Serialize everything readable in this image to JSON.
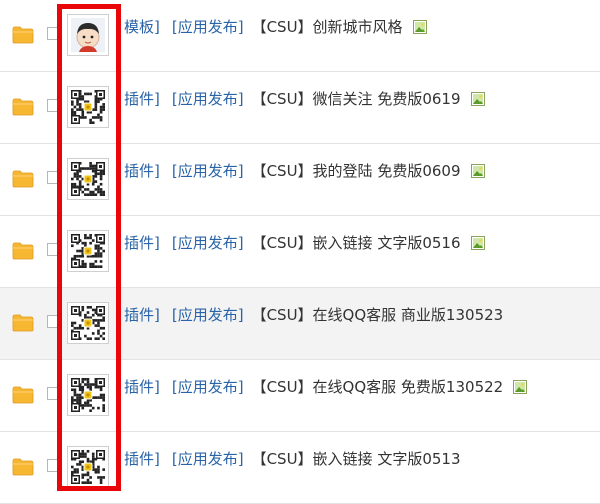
{
  "rows": [
    {
      "category": "模板]",
      "app": "[应用发布]",
      "name": "【CSU】创新城市风格",
      "thumb": "avatar",
      "image_icon": true
    },
    {
      "category": "插件]",
      "app": "[应用发布]",
      "name": "【CSU】微信关注 免费版0619",
      "thumb": "qr",
      "image_icon": true
    },
    {
      "category": "插件]",
      "app": "[应用发布]",
      "name": "【CSU】我的登陆 免费版0609",
      "thumb": "qr",
      "image_icon": true
    },
    {
      "category": "插件]",
      "app": "[应用发布]",
      "name": "【CSU】嵌入链接 文字版0516",
      "thumb": "qr",
      "image_icon": true
    },
    {
      "category": "插件]",
      "app": "[应用发布]",
      "name": "【CSU】在线QQ客服 商业版130523",
      "thumb": "qr",
      "image_icon": false
    },
    {
      "category": "插件]",
      "app": "[应用发布]",
      "name": "【CSU】在线QQ客服 免费版130522",
      "thumb": "qr",
      "image_icon": true
    },
    {
      "category": "插件]",
      "app": "[应用发布]",
      "name": "【CSU】嵌入链接 文字版0513",
      "thumb": "qr",
      "image_icon": false
    }
  ],
  "highlight_row": 4,
  "colors": {
    "link": "#2a64a8",
    "text": "#333333",
    "highlight": "#e8060b",
    "folder": "#f7b733"
  }
}
